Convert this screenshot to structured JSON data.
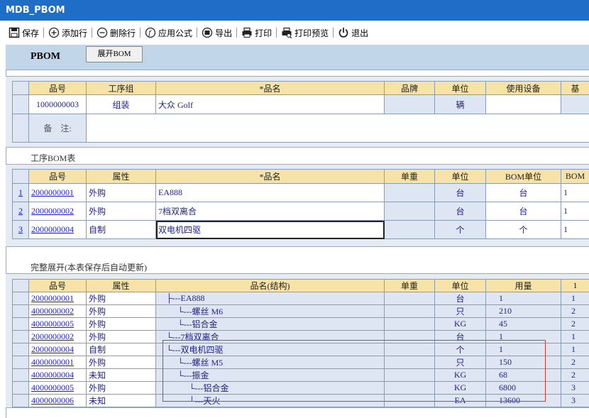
{
  "window_title": "MDB_PBOM",
  "toolbar": {
    "save": "保存",
    "add_row": "添加行",
    "delete_row": "删除行",
    "apply_formula": "应用公式",
    "export": "导出",
    "print": "打印",
    "print_preview": "打印预览",
    "exit": "退出"
  },
  "header": {
    "label": "PBOM",
    "expand_button": "展开BOM"
  },
  "product": {
    "columns": [
      "品号",
      "工序组",
      "*品名",
      "品牌",
      "单位",
      "使用设备",
      "基"
    ],
    "row": {
      "part_no": "1000000003",
      "group": "组装",
      "name": "大众 Golf",
      "brand": "",
      "unit": "辆",
      "equipment": ""
    },
    "remark_label": "备　注:",
    "remark_value": ""
  },
  "process_bom": {
    "title": "工序BOM表",
    "columns": [
      "品号",
      "属性",
      "*品名",
      "单重",
      "单位",
      "BOM单位",
      "BOM"
    ],
    "rows": [
      {
        "idx": "1",
        "part_no": "2000000001",
        "attr": "外购",
        "name": "EA888",
        "weight": "",
        "unit": "台",
        "bom_unit": "台",
        "bom": "1"
      },
      {
        "idx": "2",
        "part_no": "2000000002",
        "attr": "外购",
        "name": "7档双离合",
        "weight": "",
        "unit": "台",
        "bom_unit": "台",
        "bom": "1"
      },
      {
        "idx": "3",
        "part_no": "2000000004",
        "attr": "自制",
        "name": "双电机四驱",
        "weight": "",
        "unit": "个",
        "bom_unit": "个",
        "bom": "1"
      }
    ]
  },
  "full_expand": {
    "title": "完整展开(本表保存后自动更新)",
    "columns": [
      "品号",
      "属性",
      "品名(结构)",
      "单重",
      "单位",
      "用量",
      "1"
    ],
    "rows": [
      {
        "part_no": "2000000001",
        "attr": "外购",
        "name": "├---EA888",
        "weight": "",
        "unit": "台",
        "qty": "1",
        "level": "1"
      },
      {
        "part_no": "4000000002",
        "attr": "外购",
        "name": "└---螺丝 M6",
        "weight": "",
        "unit": "只",
        "qty": "210",
        "level": "2"
      },
      {
        "part_no": "4000000005",
        "attr": "外购",
        "name": "└---铝合金",
        "weight": "",
        "unit": "KG",
        "qty": "45",
        "level": "2"
      },
      {
        "part_no": "2000000002",
        "attr": "外购",
        "name": "└---7档双离合",
        "weight": "",
        "unit": "台",
        "qty": "1",
        "level": "1"
      },
      {
        "part_no": "2000000004",
        "attr": "自制",
        "name": "└---双电机四驱",
        "weight": "",
        "unit": "个",
        "qty": "1",
        "level": "1"
      },
      {
        "part_no": "4000000001",
        "attr": "外购",
        "name": "└---螺丝 M5",
        "weight": "",
        "unit": "只",
        "qty": "150",
        "level": "2"
      },
      {
        "part_no": "4000000004",
        "attr": "未知",
        "name": "└---振金",
        "weight": "",
        "unit": "KG",
        "qty": "68",
        "level": "2"
      },
      {
        "part_no": "4000000005",
        "attr": "外购",
        "name": "└---铝合金",
        "weight": "",
        "unit": "KG",
        "qty": "6800",
        "level": "3"
      },
      {
        "part_no": "4000000006",
        "attr": "未知",
        "name": "└---天火",
        "weight": "",
        "unit": "EA",
        "qty": "13600",
        "level": "3"
      }
    ]
  }
}
